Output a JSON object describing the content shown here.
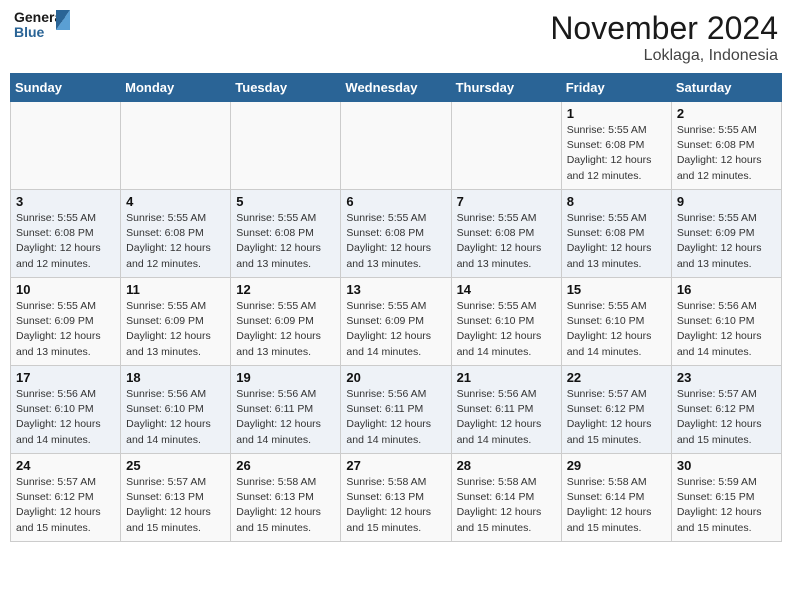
{
  "header": {
    "logo_line1": "General",
    "logo_line2": "Blue",
    "month": "November 2024",
    "location": "Loklaga, Indonesia"
  },
  "columns": [
    "Sunday",
    "Monday",
    "Tuesday",
    "Wednesday",
    "Thursday",
    "Friday",
    "Saturday"
  ],
  "weeks": [
    [
      {
        "day": "",
        "info": ""
      },
      {
        "day": "",
        "info": ""
      },
      {
        "day": "",
        "info": ""
      },
      {
        "day": "",
        "info": ""
      },
      {
        "day": "",
        "info": ""
      },
      {
        "day": "1",
        "info": "Sunrise: 5:55 AM\nSunset: 6:08 PM\nDaylight: 12 hours\nand 12 minutes."
      },
      {
        "day": "2",
        "info": "Sunrise: 5:55 AM\nSunset: 6:08 PM\nDaylight: 12 hours\nand 12 minutes."
      }
    ],
    [
      {
        "day": "3",
        "info": "Sunrise: 5:55 AM\nSunset: 6:08 PM\nDaylight: 12 hours\nand 12 minutes."
      },
      {
        "day": "4",
        "info": "Sunrise: 5:55 AM\nSunset: 6:08 PM\nDaylight: 12 hours\nand 12 minutes."
      },
      {
        "day": "5",
        "info": "Sunrise: 5:55 AM\nSunset: 6:08 PM\nDaylight: 12 hours\nand 13 minutes."
      },
      {
        "day": "6",
        "info": "Sunrise: 5:55 AM\nSunset: 6:08 PM\nDaylight: 12 hours\nand 13 minutes."
      },
      {
        "day": "7",
        "info": "Sunrise: 5:55 AM\nSunset: 6:08 PM\nDaylight: 12 hours\nand 13 minutes."
      },
      {
        "day": "8",
        "info": "Sunrise: 5:55 AM\nSunset: 6:08 PM\nDaylight: 12 hours\nand 13 minutes."
      },
      {
        "day": "9",
        "info": "Sunrise: 5:55 AM\nSunset: 6:09 PM\nDaylight: 12 hours\nand 13 minutes."
      }
    ],
    [
      {
        "day": "10",
        "info": "Sunrise: 5:55 AM\nSunset: 6:09 PM\nDaylight: 12 hours\nand 13 minutes."
      },
      {
        "day": "11",
        "info": "Sunrise: 5:55 AM\nSunset: 6:09 PM\nDaylight: 12 hours\nand 13 minutes."
      },
      {
        "day": "12",
        "info": "Sunrise: 5:55 AM\nSunset: 6:09 PM\nDaylight: 12 hours\nand 13 minutes."
      },
      {
        "day": "13",
        "info": "Sunrise: 5:55 AM\nSunset: 6:09 PM\nDaylight: 12 hours\nand 14 minutes."
      },
      {
        "day": "14",
        "info": "Sunrise: 5:55 AM\nSunset: 6:10 PM\nDaylight: 12 hours\nand 14 minutes."
      },
      {
        "day": "15",
        "info": "Sunrise: 5:55 AM\nSunset: 6:10 PM\nDaylight: 12 hours\nand 14 minutes."
      },
      {
        "day": "16",
        "info": "Sunrise: 5:56 AM\nSunset: 6:10 PM\nDaylight: 12 hours\nand 14 minutes."
      }
    ],
    [
      {
        "day": "17",
        "info": "Sunrise: 5:56 AM\nSunset: 6:10 PM\nDaylight: 12 hours\nand 14 minutes."
      },
      {
        "day": "18",
        "info": "Sunrise: 5:56 AM\nSunset: 6:10 PM\nDaylight: 12 hours\nand 14 minutes."
      },
      {
        "day": "19",
        "info": "Sunrise: 5:56 AM\nSunset: 6:11 PM\nDaylight: 12 hours\nand 14 minutes."
      },
      {
        "day": "20",
        "info": "Sunrise: 5:56 AM\nSunset: 6:11 PM\nDaylight: 12 hours\nand 14 minutes."
      },
      {
        "day": "21",
        "info": "Sunrise: 5:56 AM\nSunset: 6:11 PM\nDaylight: 12 hours\nand 14 minutes."
      },
      {
        "day": "22",
        "info": "Sunrise: 5:57 AM\nSunset: 6:12 PM\nDaylight: 12 hours\nand 15 minutes."
      },
      {
        "day": "23",
        "info": "Sunrise: 5:57 AM\nSunset: 6:12 PM\nDaylight: 12 hours\nand 15 minutes."
      }
    ],
    [
      {
        "day": "24",
        "info": "Sunrise: 5:57 AM\nSunset: 6:12 PM\nDaylight: 12 hours\nand 15 minutes."
      },
      {
        "day": "25",
        "info": "Sunrise: 5:57 AM\nSunset: 6:13 PM\nDaylight: 12 hours\nand 15 minutes."
      },
      {
        "day": "26",
        "info": "Sunrise: 5:58 AM\nSunset: 6:13 PM\nDaylight: 12 hours\nand 15 minutes."
      },
      {
        "day": "27",
        "info": "Sunrise: 5:58 AM\nSunset: 6:13 PM\nDaylight: 12 hours\nand 15 minutes."
      },
      {
        "day": "28",
        "info": "Sunrise: 5:58 AM\nSunset: 6:14 PM\nDaylight: 12 hours\nand 15 minutes."
      },
      {
        "day": "29",
        "info": "Sunrise: 5:58 AM\nSunset: 6:14 PM\nDaylight: 12 hours\nand 15 minutes."
      },
      {
        "day": "30",
        "info": "Sunrise: 5:59 AM\nSunset: 6:15 PM\nDaylight: 12 hours\nand 15 minutes."
      }
    ]
  ]
}
